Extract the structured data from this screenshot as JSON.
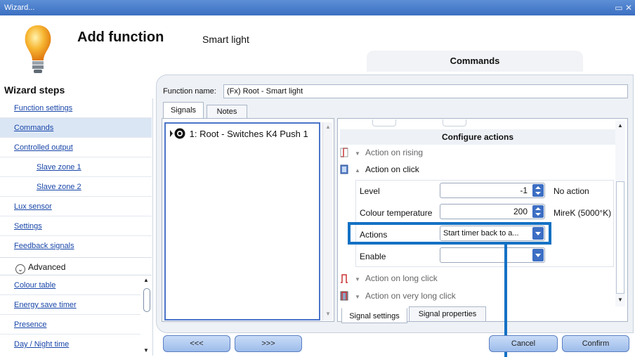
{
  "window": {
    "title": "Wizard...",
    "controls": "▭ ✕"
  },
  "header": {
    "title": "Add function",
    "subtitle": "Smart light",
    "section_tab": "Commands"
  },
  "wizard_steps": {
    "heading": "Wizard steps",
    "items": [
      {
        "label": "Function settings"
      },
      {
        "label": "Commands"
      },
      {
        "label": "Controlled output"
      },
      {
        "label": "Slave zone 1"
      },
      {
        "label": "Slave zone 2"
      },
      {
        "label": "Lux sensor"
      },
      {
        "label": "Settings"
      },
      {
        "label": "Feedback signals"
      }
    ],
    "advanced_label": "Advanced",
    "advanced_items": [
      {
        "label": "Colour table"
      },
      {
        "label": "Energy save timer"
      },
      {
        "label": "Presence"
      },
      {
        "label": "Day / Night time"
      }
    ]
  },
  "function_name": {
    "label": "Function name:",
    "value": "(Fx) Root - Smart light"
  },
  "tabs": {
    "signals": "Signals",
    "notes": "Notes"
  },
  "signals_list": [
    {
      "label": "1: Root - Switches K4 Push 1"
    }
  ],
  "configure": {
    "heading": "Configure actions",
    "action_rising": "Action on rising",
    "action_click": "Action on click",
    "action_long": "Action on long click",
    "action_very_long": "Action on very long click",
    "fields": {
      "level_label": "Level",
      "level_value": "-1",
      "level_unit": "No action",
      "colour_label": "Colour temperature",
      "colour_value": "200",
      "colour_unit": "MireK (5000°K)",
      "actions_label": "Actions",
      "actions_value": "Start timer back to a...",
      "enable_label": "Enable",
      "enable_value": ""
    }
  },
  "bottom_tabs": {
    "settings": "Signal settings",
    "properties": "Signal properties"
  },
  "buttons": {
    "prev": "<<<",
    "next": ">>>",
    "cancel": "Cancel",
    "confirm": "Confirm"
  }
}
